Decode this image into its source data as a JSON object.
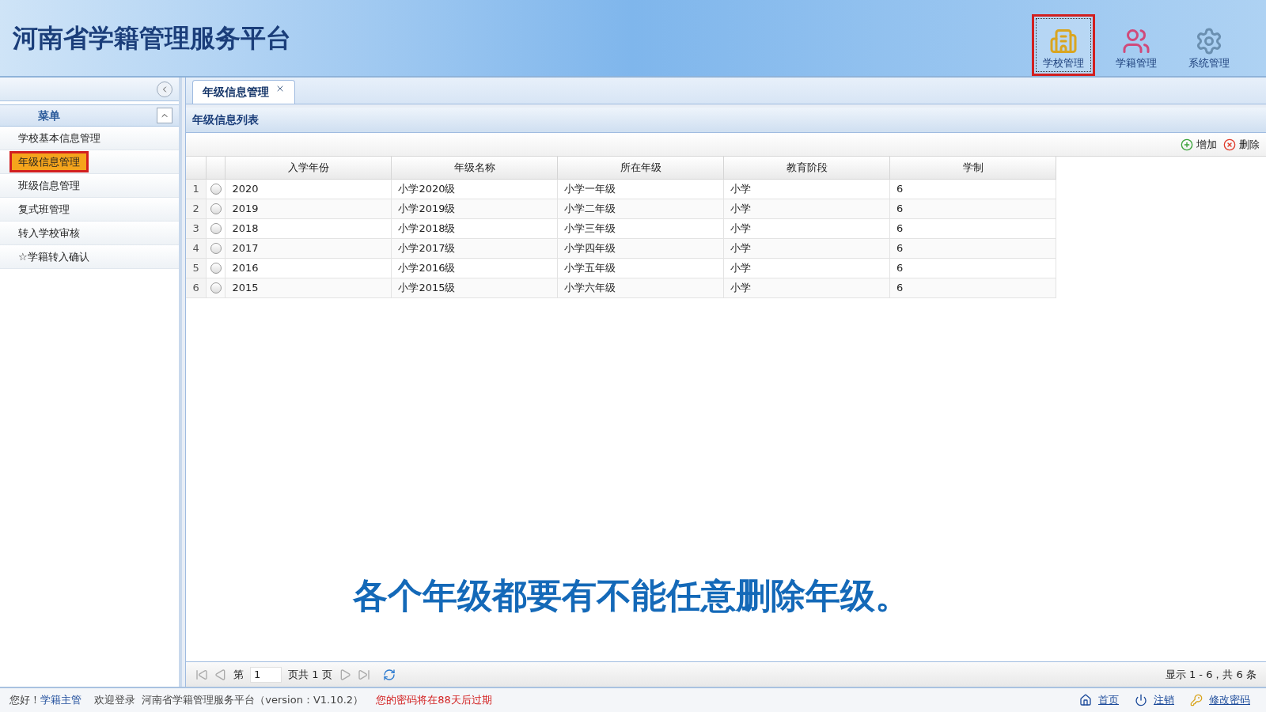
{
  "header": {
    "title": "河南省学籍管理服务平台",
    "nav": [
      {
        "label": "学校管理",
        "kind": "school",
        "selected": true,
        "annotated": true
      },
      {
        "label": "学籍管理",
        "kind": "people",
        "selected": false,
        "annotated": false
      },
      {
        "label": "系统管理",
        "kind": "settings",
        "selected": false,
        "annotated": false
      }
    ]
  },
  "sidebar": {
    "title": "菜单",
    "items": [
      {
        "label": "学校基本信息管理",
        "selected": false,
        "annotated": false
      },
      {
        "label": "年级信息管理",
        "selected": true,
        "annotated": true
      },
      {
        "label": "班级信息管理",
        "selected": false,
        "annotated": false
      },
      {
        "label": "复式班管理",
        "selected": false,
        "annotated": false
      },
      {
        "label": "转入学校审核",
        "selected": false,
        "annotated": false
      },
      {
        "label": "☆学籍转入确认",
        "selected": false,
        "annotated": false
      }
    ]
  },
  "tabs": [
    {
      "label": "年级信息管理",
      "selected": true
    }
  ],
  "panel": {
    "title": "年级信息列表",
    "toolbar": [
      {
        "label": "增加",
        "kind": "add"
      },
      {
        "label": "删除",
        "kind": "delete"
      }
    ],
    "table": {
      "columns": [
        "入学年份",
        "年级名称",
        "所在年级",
        "教育阶段",
        "学制"
      ],
      "rows": [
        {
          "number": "1",
          "selected": false,
          "cells": [
            "2020",
            "小学2020级",
            "小学一年级",
            "小学",
            "6"
          ]
        },
        {
          "number": "2",
          "selected": false,
          "cells": [
            "2019",
            "小学2019级",
            "小学二年级",
            "小学",
            "6"
          ]
        },
        {
          "number": "3",
          "selected": false,
          "cells": [
            "2018",
            "小学2018级",
            "小学三年级",
            "小学",
            "6"
          ]
        },
        {
          "number": "4",
          "selected": false,
          "cells": [
            "2017",
            "小学2017级",
            "小学四年级",
            "小学",
            "6"
          ]
        },
        {
          "number": "5",
          "selected": false,
          "cells": [
            "2016",
            "小学2016级",
            "小学五年级",
            "小学",
            "6"
          ]
        },
        {
          "number": "6",
          "selected": false,
          "cells": [
            "2015",
            "小学2015级",
            "小学六年级",
            "小学",
            "6"
          ]
        }
      ]
    },
    "pager": {
      "page_prefix": "第",
      "page": "1",
      "page_suffix": "页共 1 页",
      "summary": "显示 1 - 6，共 6 条"
    }
  },
  "caption": "各个年级都要有不能任意删除年级。",
  "status_bar": {
    "greeting": "您好！",
    "user": "学籍主管",
    "welcome": "欢迎登录  河南省学籍管理服务平台（version：V1.10.2）",
    "warning": "您的密码将在88天后过期",
    "links": [
      {
        "label": "首页",
        "kind": "home"
      },
      {
        "label": "注销",
        "kind": "logout"
      },
      {
        "label": "修改密码",
        "kind": "key"
      }
    ]
  }
}
